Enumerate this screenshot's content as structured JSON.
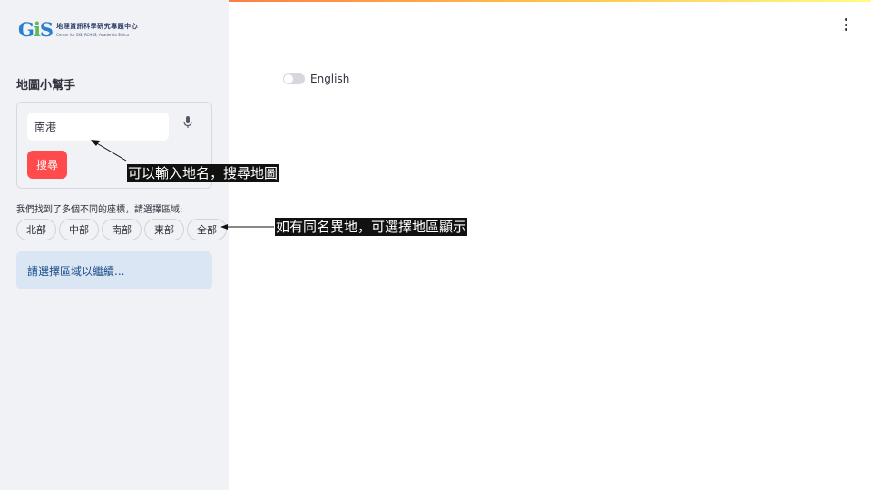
{
  "logo": {
    "cn": "地理資訊科學研究專題中心",
    "en": "Center for GIS, RCHSS, Academia Sinica"
  },
  "sidebar": {
    "title": "地圖小幫手",
    "search": {
      "value": "南港",
      "placeholder": ""
    },
    "search_button": "搜尋",
    "found_text": "我們找到了多個不同的座標，請選擇區域:",
    "regions": [
      "北部",
      "中部",
      "南部",
      "東部",
      "全部"
    ],
    "info": "請選擇區域以繼續..."
  },
  "main": {
    "toggle_label": "English",
    "toggle_on": false
  },
  "annotations": {
    "input_hint": "可以輸入地名，搜尋地圖",
    "region_hint": "如有同名異地，可選擇地區顯示"
  },
  "colors": {
    "accent": "#ff4b4b",
    "sidebar_bg": "#f0f2f6",
    "info_bg": "#dbe6f4",
    "info_text": "#1c4f8c"
  },
  "icons": [
    "microphone-icon",
    "more-vert-icon"
  ]
}
